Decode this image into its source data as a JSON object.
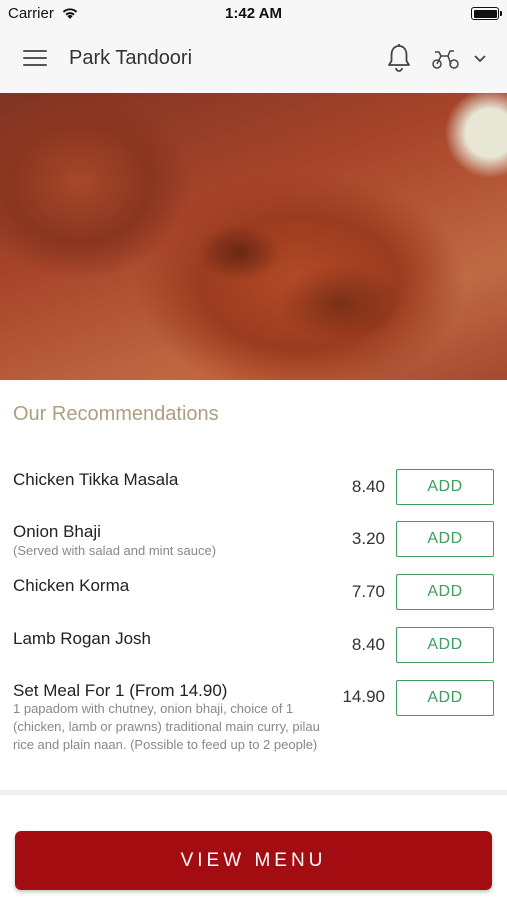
{
  "status_bar": {
    "carrier": "Carrier",
    "time": "1:42 AM"
  },
  "header": {
    "title": "Park Tandoori"
  },
  "recommendations": {
    "title": "Our Recommendations",
    "add_label": "ADD",
    "items": [
      {
        "name": "Chicken Tikka Masala",
        "description": "",
        "price": "8.40"
      },
      {
        "name": "Onion Bhaji",
        "description": "(Served with salad and mint sauce)",
        "price": "3.20"
      },
      {
        "name": "Chicken Korma",
        "description": "",
        "price": "7.70"
      },
      {
        "name": "Lamb Rogan Josh",
        "description": "",
        "price": "8.40"
      },
      {
        "name": "Set Meal For 1 (From 14.90)",
        "description": "1 papadom with chutney, onion bhaji, choice of 1 (chicken, lamb or prawns) traditional main curry, pilau rice and plain naan. (Possible to feed up to 2 people)",
        "price": "14.90"
      }
    ]
  },
  "footer": {
    "view_menu_label": "VIEW MENU"
  },
  "colors": {
    "accent_green": "#3e9d5f",
    "brand_red": "#a30d12",
    "section_title": "#ad9f80"
  }
}
